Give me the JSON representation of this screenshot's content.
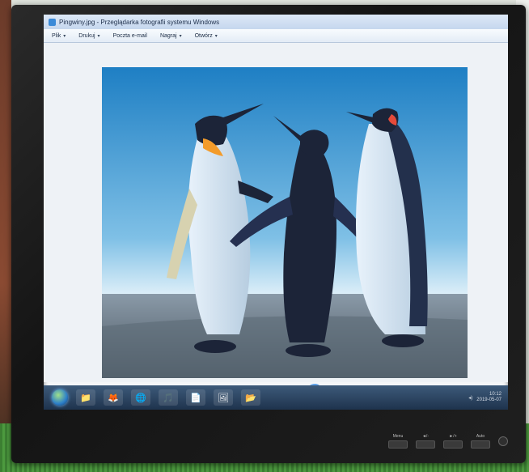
{
  "window": {
    "title": "Pingwiny.jpg - Przeglądarka fotografii systemu Windows"
  },
  "menu": [
    {
      "label": "Plik",
      "caret": "▾"
    },
    {
      "label": "Drukuj",
      "caret": "▾"
    },
    {
      "label": "Poczta e-mail",
      "caret": ""
    },
    {
      "label": "Nagraj",
      "caret": "▾"
    },
    {
      "label": "Otwórz",
      "caret": "▾"
    }
  ],
  "controls": {
    "zoom": "⌕",
    "fit": "⤢",
    "prev": "⏮",
    "play": "▶",
    "next": "⏭",
    "rotate_left": "↺",
    "rotate_right": "↻",
    "delete": "✕"
  },
  "tray": {
    "time": "10:12",
    "date": "2019-05-07"
  },
  "taskbar": {
    "apps": [
      "📁",
      "🦊",
      "🌐",
      "🎵",
      "📄",
      "🖼",
      "📂"
    ]
  },
  "bezel": {
    "buttons": [
      "Menu",
      "◄/-",
      "►/+",
      "Auto"
    ]
  },
  "colors": {
    "sky_top": "#1e7fc4",
    "sky_bottom": "#cfe8f5",
    "penguin_dark": "#1c2438",
    "taskbar": "#24405f"
  }
}
